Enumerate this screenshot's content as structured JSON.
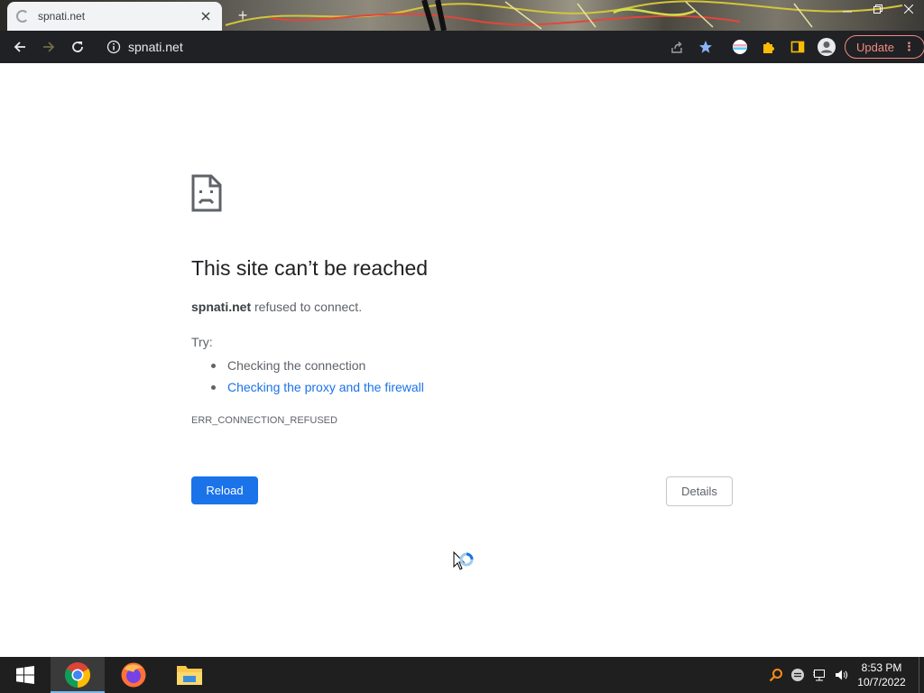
{
  "browser": {
    "tab": {
      "title": "spnati.net"
    },
    "omnibox": {
      "url": "spnati.net"
    },
    "update_label": "Update",
    "colors": {
      "frame": "#202124",
      "accent": "#1a73e8",
      "update": "#f28b82"
    }
  },
  "page": {
    "title": "This site can’t be reached",
    "message": {
      "host": "spnati.net",
      "text": " refused to connect."
    },
    "try_label": "Try:",
    "suggestions": [
      {
        "text": "Checking the connection",
        "link": false
      },
      {
        "text": "Checking the proxy and the firewall",
        "link": true
      }
    ],
    "error_code": "ERR_CONNECTION_REFUSED",
    "buttons": {
      "reload": "Reload",
      "details": "Details"
    }
  },
  "taskbar": {
    "apps": [
      "chrome-icon",
      "firefox-icon",
      "file-explorer-icon"
    ],
    "clock": {
      "time": "8:53 PM",
      "date": "10/7/2022"
    }
  }
}
